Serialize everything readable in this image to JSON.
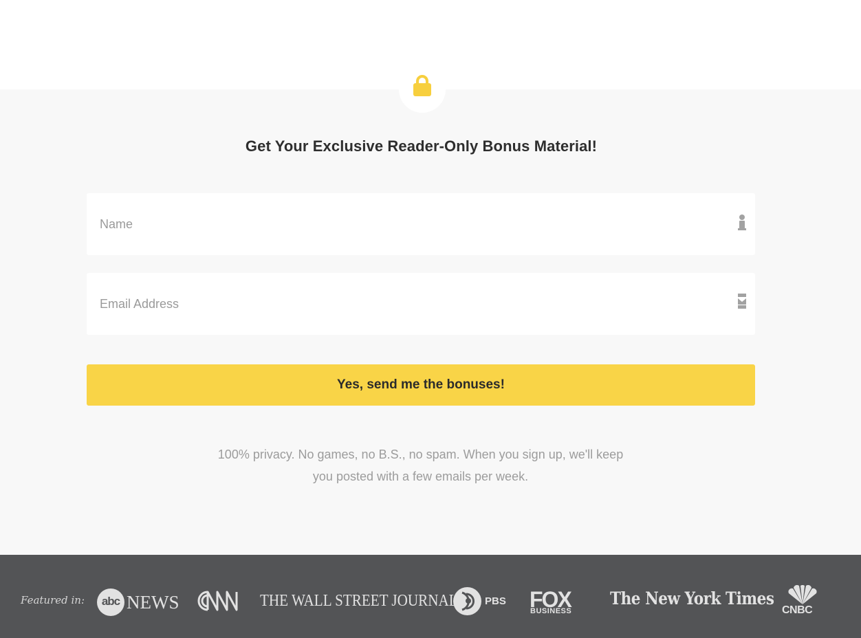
{
  "optin": {
    "headline": "Get Your Exclusive Reader-Only Bonus Material!",
    "name_field": {
      "placeholder": "Name",
      "value": "",
      "icon": "user-icon"
    },
    "email_field": {
      "placeholder": "Email Address",
      "value": "",
      "icon": "envelope-icon"
    },
    "submit_label": "Yes, send me the bonuses!",
    "privacy_note": "100% privacy. No games, no B.S., no spam. When you sign up, we'll keep you posted with a few emails per week.",
    "lock_icon": "lock-icon"
  },
  "footer": {
    "featured_label": "Featured in:",
    "logos": {
      "abc_mark": "abc",
      "abc_word": "NEWS",
      "cnn": "CNN",
      "wsj": "THE WALL STREET JOURNAL.",
      "pbs": "PBS",
      "fox_word": "FOX",
      "fox_sub": "BUSINESS",
      "nyt": "The New York Times",
      "cnbc": "CNBC"
    }
  },
  "colors": {
    "accent_yellow": "#f9d447",
    "lock_yellow": "#f7cf3e",
    "section_bg": "#f8f8f8",
    "footer_bg": "#535456",
    "headline_text": "#2e2e2e",
    "muted_text": "#9c9c9c"
  }
}
